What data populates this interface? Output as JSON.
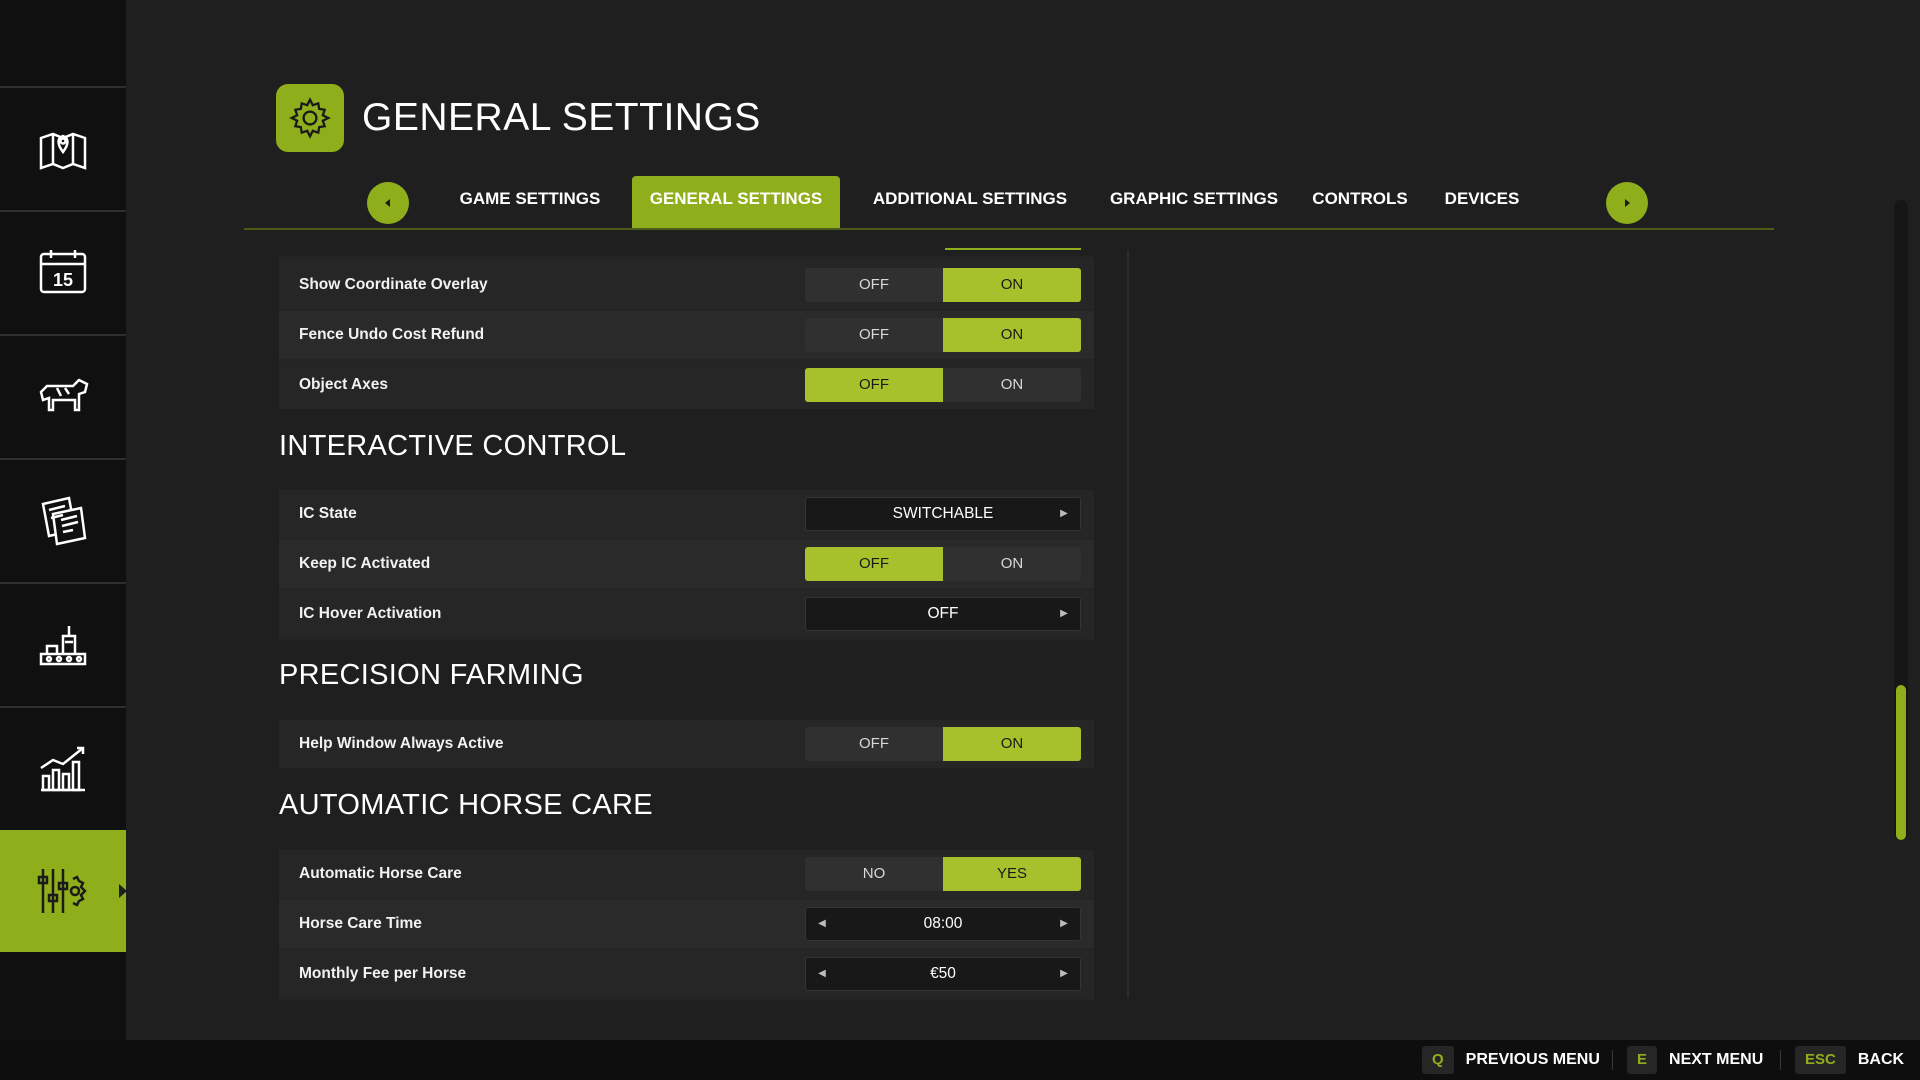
{
  "header": {
    "title": "GENERAL SETTINGS",
    "icon": "gear-icon"
  },
  "sidebar": {
    "items": [
      {
        "name": "map",
        "icon": "map-icon"
      },
      {
        "name": "calendar",
        "icon": "calendar-icon",
        "badge": "15"
      },
      {
        "name": "animals",
        "icon": "cow-icon"
      },
      {
        "name": "contracts",
        "icon": "documents-icon"
      },
      {
        "name": "production",
        "icon": "production-icon"
      },
      {
        "name": "statistics",
        "icon": "chart-icon"
      },
      {
        "name": "settings",
        "icon": "settings-sliders-icon",
        "active": true
      }
    ]
  },
  "tabs": [
    {
      "label": "GAME SETTINGS"
    },
    {
      "label": "GENERAL SETTINGS",
      "active": true
    },
    {
      "label": "ADDITIONAL SETTINGS"
    },
    {
      "label": "GRAPHIC SETTINGS"
    },
    {
      "label": "CONTROLS"
    },
    {
      "label": "DEVICES"
    }
  ],
  "settings": {
    "top_rows": [
      {
        "label": "Show Coordinate Overlay",
        "off": "OFF",
        "on": "ON",
        "value": "ON"
      },
      {
        "label": "Fence Undo Cost Refund",
        "off": "OFF",
        "on": "ON",
        "value": "ON"
      },
      {
        "label": "Object Axes",
        "off": "OFF",
        "on": "ON",
        "value": "OFF"
      }
    ],
    "interactive_control": {
      "title": "INTERACTIVE CONTROL",
      "ic_state": {
        "label": "IC State",
        "value": "SWITCHABLE"
      },
      "keep_ic": {
        "label": "Keep IC Activated",
        "off": "OFF",
        "on": "ON",
        "value": "OFF"
      },
      "ic_hover": {
        "label": "IC Hover Activation",
        "value": "OFF"
      }
    },
    "precision_farming": {
      "title": "PRECISION FARMING",
      "help_window": {
        "label": "Help Window Always Active",
        "off": "OFF",
        "on": "ON",
        "value": "ON"
      }
    },
    "horse_care": {
      "title": "AUTOMATIC HORSE CARE",
      "auto": {
        "label": "Automatic Horse Care",
        "off": "NO",
        "on": "YES",
        "value": "YES"
      },
      "time": {
        "label": "Horse Care Time",
        "value": "08:00"
      },
      "fee": {
        "label": "Monthly Fee per Horse",
        "value": "€50"
      }
    }
  },
  "bottombar": {
    "prev": {
      "key": "Q",
      "label": "PREVIOUS MENU"
    },
    "next": {
      "key": "E",
      "label": "NEXT MENU"
    },
    "back": {
      "key": "ESC",
      "label": "BACK"
    }
  },
  "colors": {
    "accent": "#8fae1b",
    "toggle_selected": "#a6c12b",
    "background": "#1f1f1f",
    "sidebar": "#101010"
  }
}
